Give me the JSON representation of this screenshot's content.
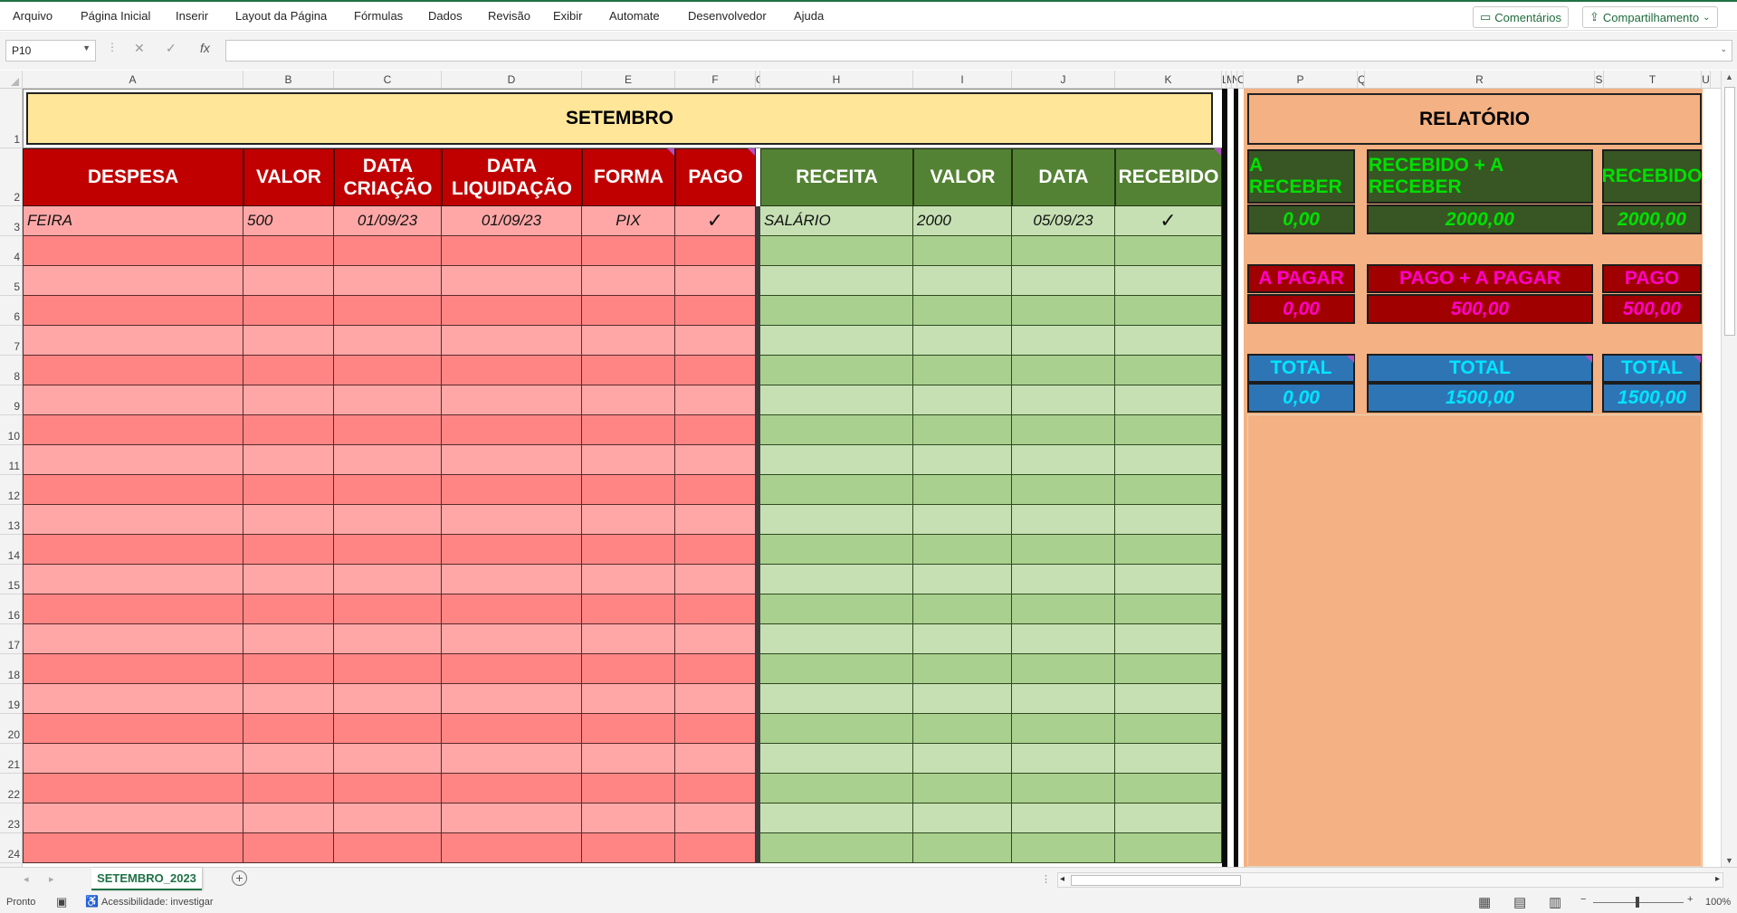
{
  "menu": {
    "items": [
      "Arquivo",
      "Página Inicial",
      "Inserir",
      "Layout da Página",
      "Fórmulas",
      "Dados",
      "Revisão",
      "Exibir",
      "Automate",
      "Desenvolvedor",
      "Ajuda"
    ],
    "comments_label": "Comentários",
    "share_label": "Compartilhamento"
  },
  "formula_bar": {
    "name_box": "P10",
    "formula": ""
  },
  "columns": [
    "A",
    "B",
    "C",
    "D",
    "E",
    "F",
    "G",
    "H",
    "I",
    "J",
    "K",
    "L",
    "M",
    "N",
    "O",
    "P",
    "Q",
    "R",
    "S",
    "T",
    "U"
  ],
  "rows": [
    "1",
    "2",
    "3",
    "4",
    "5",
    "6",
    "7",
    "8",
    "9",
    "10",
    "11",
    "12",
    "13",
    "14",
    "15",
    "16",
    "17",
    "18",
    "19",
    "20",
    "21",
    "22",
    "23",
    "24"
  ],
  "title": "SETEMBRO",
  "expenses": {
    "headers": [
      "DESPESA",
      "VALOR",
      "DATA CRIAÇÃO",
      "DATA LIQUIDAÇÃO",
      "FORMA",
      "PAGO"
    ],
    "row": [
      "FEIRA",
      "500",
      "01/09/23",
      "01/09/23",
      "PIX",
      "✓"
    ]
  },
  "income": {
    "headers": [
      "RECEITA",
      "VALOR",
      "DATA",
      "RECEBIDO"
    ],
    "row": [
      "SALÁRIO",
      "2000",
      "05/09/23",
      "✓"
    ]
  },
  "report": {
    "title": "RELATÓRIO",
    "receivable": {
      "labels": [
        "A RECEBER",
        "RECEBIDO + A RECEBER",
        "RECEBIDO"
      ],
      "values": [
        "0,00",
        "2000,00",
        "2000,00"
      ]
    },
    "payable": {
      "labels": [
        "A PAGAR",
        "PAGO + A PAGAR",
        "PAGO"
      ],
      "values": [
        "0,00",
        "500,00",
        "500,00"
      ]
    },
    "total": {
      "labels": [
        "TOTAL",
        "TOTAL",
        "TOTAL"
      ],
      "values": [
        "0,00",
        "1500,00",
        "1500,00"
      ]
    }
  },
  "colors": {
    "expense_header": "#c00000",
    "expense_light": "#ffa7a7",
    "expense_dark": "#ff8585",
    "income_header": "#548235",
    "income_light": "#c6e0b4",
    "income_dark": "#a9d08e",
    "report_bg": "#f4b183",
    "title_bg": "#ffe699",
    "receivable_bg": "#375623",
    "receivable_text": "#00e000",
    "payable_bg": "#a00000",
    "payable_text": "#ff00c8",
    "total_bg": "#2e75b6",
    "total_text": "#00e5ff"
  },
  "tabs": {
    "active": "SETEMBRO_2023"
  },
  "status": {
    "ready": "Pronto",
    "accessibility": "Acessibilidade: investigar",
    "zoom": "100%"
  }
}
